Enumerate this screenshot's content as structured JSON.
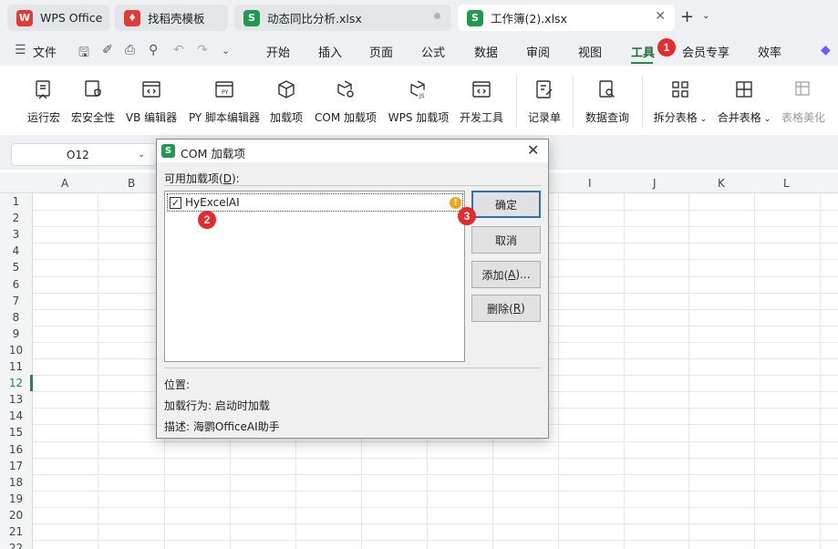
{
  "tabs": [
    {
      "label": "WPS Office",
      "logo": "W",
      "logo_color": "#e53935"
    },
    {
      "label": "找稻壳模板",
      "logo": "稻",
      "logo_color": "#e53935"
    },
    {
      "label": "动态同比分析.xlsx",
      "logo": "S",
      "logo_color": "#1e9a4c"
    },
    {
      "label": "工作簿(2).xlsx",
      "logo": "S",
      "logo_color": "#1e9a4c"
    }
  ],
  "menu": {
    "file": "文件",
    "items": [
      "开始",
      "插入",
      "页面",
      "公式",
      "数据",
      "审阅",
      "视图",
      "工具",
      "会员专享",
      "效率"
    ],
    "active": "工具"
  },
  "ribbon": {
    "buttons": [
      "运行宏",
      "宏安全性",
      "VB 编辑器",
      "PY 脚本编辑器",
      "加载项",
      "COM 加载项",
      "WPS 加载项",
      "开发工具",
      "记录单",
      "数据查询",
      "拆分表格",
      "合并表格",
      "表格美化"
    ]
  },
  "namebox": {
    "value": "O12"
  },
  "grid": {
    "columns": [
      "A",
      "B",
      "I",
      "J",
      "K",
      "L"
    ],
    "rows": [
      "1",
      "2",
      "3",
      "4",
      "5",
      "6",
      "7",
      "8",
      "9",
      "10",
      "11",
      "12",
      "13",
      "14",
      "15",
      "16",
      "17",
      "18",
      "19",
      "20",
      "21",
      "22"
    ],
    "selected_row": "12"
  },
  "dialog": {
    "title": "COM 加载项",
    "available_label": "可用加载项(",
    "available_key": "D",
    "available_suffix": "):",
    "addin_name": "HyExcelAI",
    "addin_checked": "✓",
    "warning_glyph": "!",
    "buttons": {
      "ok": "确定",
      "cancel": "取消",
      "add_prefix": "添加(",
      "add_key": "A",
      "add_suffix": ")...",
      "remove_prefix": "删除(",
      "remove_key": "R",
      "remove_suffix": ")"
    },
    "location_label": "位置:",
    "load_behavior_label": "加载行为:",
    "load_behavior_value": "启动时加载",
    "description_label": "描述:",
    "description_value": "海鹦OfficeAI助手"
  },
  "annotations": [
    "1",
    "2",
    "3"
  ],
  "colors": {
    "accent_green": "#1c8a48",
    "annotation_red": "#e52b2b",
    "focus_blue": "#2a6fc9"
  }
}
